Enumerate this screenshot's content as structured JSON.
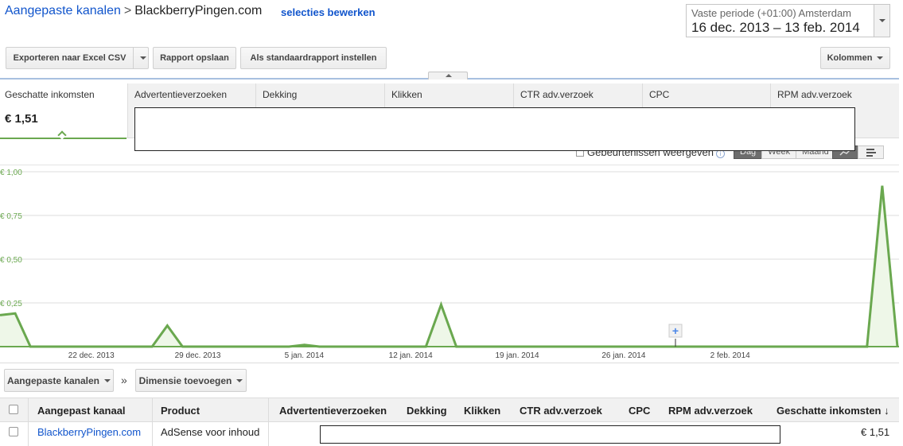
{
  "breadcrumb": {
    "parent": "Aangepaste kanalen",
    "separator": ">",
    "current": "BlackberryPingen.com",
    "edit_link": "selecties bewerken"
  },
  "date_range": {
    "label": "Vaste periode (+01:00) Amsterdam",
    "value": "16 dec. 2013 – 13 feb. 2014"
  },
  "toolbar": {
    "export_label": "Exporteren naar Excel CSV",
    "save_report_label": "Rapport opslaan",
    "default_report_label": "Als standaardrapport instellen",
    "columns_label": "Kolommen"
  },
  "metric_tabs": [
    {
      "name": "Geschatte inkomsten",
      "value": "€ 1,51"
    },
    {
      "name": "Advertentieverzoeken"
    },
    {
      "name": "Dekking"
    },
    {
      "name": "Klikken"
    },
    {
      "name": "CTR adv.verzoek"
    },
    {
      "name": "CPC"
    },
    {
      "name": "RPM adv.verzoek"
    }
  ],
  "chart_controls": {
    "events_label": "Gebeurtenissen weergeven",
    "granularity": [
      "Dag",
      "Week",
      "Maand"
    ],
    "selected_granularity": "Dag"
  },
  "chart_data": {
    "type": "area",
    "color": "#6aa84f",
    "y_ticks": [
      "€ 1,00",
      "€ 0,75",
      "€ 0,50",
      "€ 0,25"
    ],
    "ylim": [
      0,
      1
    ],
    "x_ticks": [
      "22 dec. 2013",
      "29 dec. 2013",
      "5 jan. 2014",
      "12 jan. 2014",
      "19 jan. 2014",
      "26 jan. 2014",
      "2 feb. 2014"
    ],
    "x_start": "2013-12-16",
    "x_end": "2014-02-13",
    "series": [
      {
        "values": [
          {
            "x": "2013-12-16",
            "y": 0.18
          },
          {
            "x": "2013-12-17",
            "y": 0.19
          },
          {
            "x": "2013-12-18",
            "y": 0
          },
          {
            "x": "2013-12-26",
            "y": 0
          },
          {
            "x": "2013-12-27",
            "y": 0.12
          },
          {
            "x": "2013-12-28",
            "y": 0
          },
          {
            "x": "2014-01-04",
            "y": 0
          },
          {
            "x": "2014-01-05",
            "y": 0.01
          },
          {
            "x": "2014-01-06",
            "y": 0
          },
          {
            "x": "2014-01-13",
            "y": 0
          },
          {
            "x": "2014-01-14",
            "y": 0.24
          },
          {
            "x": "2014-01-15",
            "y": 0
          },
          {
            "x": "2014-02-11",
            "y": 0
          },
          {
            "x": "2014-02-12",
            "y": 0.92
          },
          {
            "x": "2014-02-13",
            "y": 0
          }
        ]
      }
    ]
  },
  "table_toolbar": {
    "dimension_select": "Aangepaste kanalen",
    "separator": "»",
    "add_dimension": "Dimensie toevoegen"
  },
  "table": {
    "headers": [
      "Aangepast kanaal",
      "Product",
      "Advertentieverzoeken",
      "Dekking",
      "Klikken",
      "CTR adv.verzoek",
      "CPC",
      "RPM adv.verzoek",
      "Geschatte inkomsten ↓"
    ],
    "rows": [
      {
        "channel": "BlackberryPingen.com",
        "product": "AdSense voor inhoud",
        "earnings": "€ 1,51"
      }
    ]
  }
}
